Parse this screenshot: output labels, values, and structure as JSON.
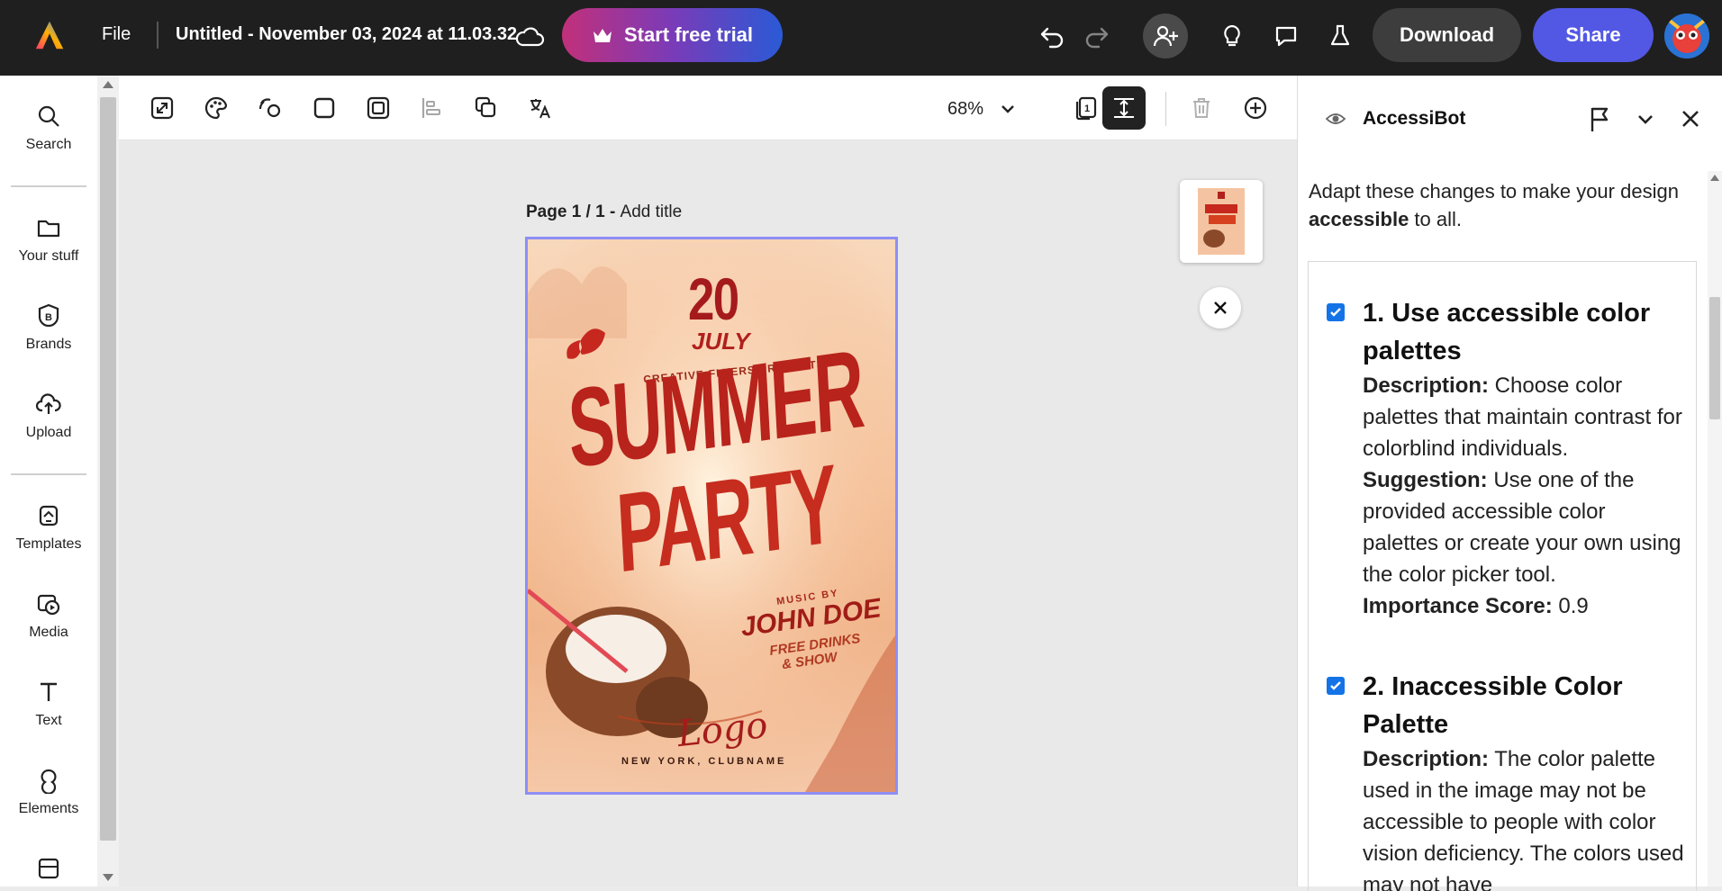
{
  "topbar": {
    "file_label": "File",
    "doc_title": "Untitled - November 03, 2024 at 11.03.32",
    "trial_label": "Start free trial",
    "download_label": "Download",
    "share_label": "Share"
  },
  "leftnav": {
    "items": [
      {
        "label": "Search",
        "icon": "search-icon"
      },
      {
        "label": "Your stuff",
        "icon": "folder-icon"
      },
      {
        "label": "Brands",
        "icon": "brand-icon"
      },
      {
        "label": "Upload",
        "icon": "upload-icon"
      },
      {
        "label": "Templates",
        "icon": "templates-icon"
      },
      {
        "label": "Media",
        "icon": "media-icon"
      },
      {
        "label": "Text",
        "icon": "text-icon"
      },
      {
        "label": "Elements",
        "icon": "elements-icon"
      }
    ]
  },
  "toolbar": {
    "zoom": "68%"
  },
  "canvas": {
    "page_prefix": "Page 1 / 1 - ",
    "page_title_placeholder": "Add title",
    "poster": {
      "day": "20",
      "month": "JULY",
      "presents": "CREATIVE-FLYERS PRESENTS",
      "line1": "SUMMER",
      "line2": "PARTY",
      "music_by": "MUSIC BY",
      "artist": "JOHN DOE",
      "drinks1": "FREE DRINKS",
      "drinks2": "& SHOW",
      "logo": "Logo",
      "venue": "NEW YORK, CLUBNAME"
    }
  },
  "panel": {
    "title": "AccessiBot",
    "intro_pre": "Adapt these changes to make your design ",
    "intro_bold": "accessible",
    "intro_post": " to all.",
    "recommendations": [
      {
        "title": "1. Use accessible color palettes",
        "desc_label": "Description:",
        "desc": " Choose color palettes that maintain contrast for colorblind individuals.",
        "sugg_label": "Suggestion:",
        "sugg": " Use one of the provided accessible color palettes or create your own using the color picker tool.",
        "score_label": "Importance Score:",
        "score": " 0.9"
      },
      {
        "title": "2. Inaccessible Color Palette",
        "desc_label": "Description:",
        "desc": " The color palette used in the image may not be accessible to people with color vision deficiency. The colors used may not have"
      }
    ]
  },
  "colors": {
    "topbar_bg": "#1f1f1f",
    "share": "#5258e4",
    "checkbox": "#1473e6",
    "selection": "#8e8ef5"
  }
}
